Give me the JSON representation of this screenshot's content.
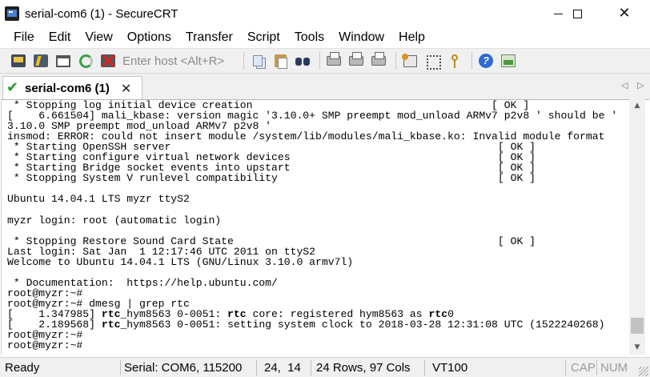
{
  "window": {
    "title": "serial-com6 (1) - SecureCRT",
    "minimize_label": "",
    "maximize_label": "",
    "close_glyph": "✕"
  },
  "menu": {
    "items": [
      "File",
      "Edit",
      "View",
      "Options",
      "Transfer",
      "Script",
      "Tools",
      "Window",
      "Help"
    ]
  },
  "toolbar": {
    "host_placeholder": "Enter host <Alt+R>",
    "icons": [
      "connect-icon",
      "quick-connect-icon",
      "connect-in-tab-icon",
      "reconnect-icon",
      "disconnect-icon",
      "copy-icon",
      "paste-icon",
      "find-icon",
      "print-icon",
      "print-screen-icon",
      "print-setup-icon",
      "session-options-icon",
      "global-options-icon",
      "keymap-icon",
      "help-icon",
      "screenshot-icon"
    ]
  },
  "tabs": [
    {
      "label": "serial-com6 (1)",
      "status_glyph": "✔",
      "close_glyph": "✕",
      "active": true
    }
  ],
  "tab_nav": {
    "left": "◁",
    "right": "▷"
  },
  "terminal": {
    "lines": [
      [
        " * Stopping log initial device creation                                      [ OK ]"
      ],
      [
        "[    6.661504] mali_kbase: version magic '3.10.0+ SMP preempt mod_unload ARMv7 p2v8 ' should be '"
      ],
      [
        "3.10.0 SMP preempt mod_unload ARMv7 p2v8 '"
      ],
      [
        "insmod: ERROR: could not insert module /system/lib/modules/mali_kbase.ko: Invalid module format"
      ],
      [
        " * Starting OpenSSH server                                                    [ OK ]"
      ],
      [
        " * Starting configure virtual network devices                                 [ OK ]"
      ],
      [
        " * Starting Bridge socket events into upstart                                 [ OK ]"
      ],
      [
        " * Stopping System V runlevel compatibility                                   [ OK ]"
      ],
      [
        ""
      ],
      [
        "Ubuntu 14.04.1 LTS myzr ttyS2"
      ],
      [
        ""
      ],
      [
        "myzr login: root (automatic login)"
      ],
      [
        ""
      ],
      [
        " * Stopping Restore Sound Card State                                          [ OK ]"
      ],
      [
        "Last login: Sat Jan  1 12:17:46 UTC 2011 on ttyS2"
      ],
      [
        "Welcome to Ubuntu 14.04.1 LTS (GNU/Linux 3.10.0 armv7l)"
      ],
      [
        ""
      ],
      [
        " * Documentation:  https://help.ubuntu.com/"
      ],
      [
        "root@myzr:~#"
      ],
      [
        "root@myzr:~# dmesg | grep rtc"
      ],
      [
        "[    1.347985] ",
        {
          "b": "rtc"
        },
        "_hym8563 0-0051: ",
        {
          "b": "rtc"
        },
        " core: registered hym8563 as ",
        {
          "b": "rtc"
        },
        "0"
      ],
      [
        "[    2.189568] ",
        {
          "b": "rtc"
        },
        "_hym8563 0-0051: setting system clock to 2018-03-28 12:31:08 UTC (1522240268)"
      ],
      [
        "root@myzr:~#"
      ],
      [
        "root@myzr:~#"
      ]
    ]
  },
  "scrollbar": {
    "up_glyph": "▲",
    "down_glyph": "▼"
  },
  "status": {
    "ready": "Ready",
    "connection": "Serial: COM6, 115200",
    "cursor": "24,  14",
    "size": "24 Rows, 97 Cols",
    "emulation": "VT100",
    "cap": "CAP",
    "num": "NUM"
  }
}
